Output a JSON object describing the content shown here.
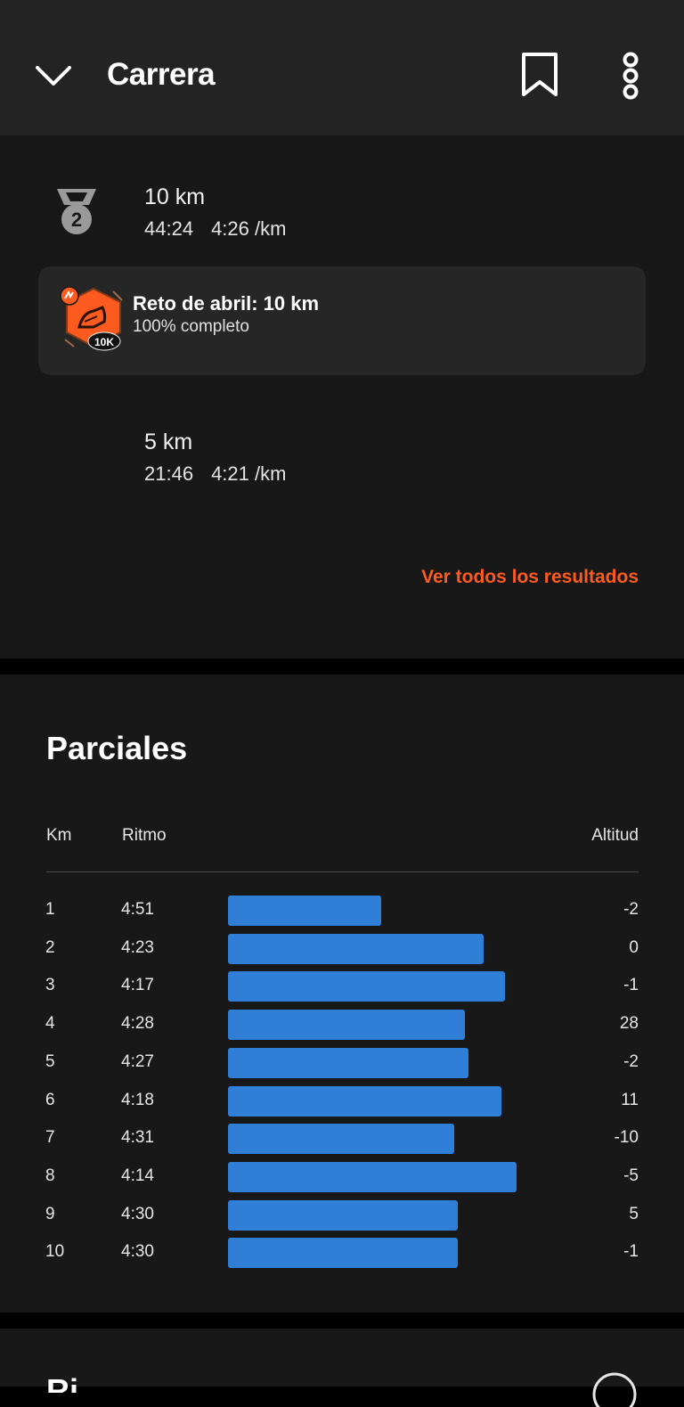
{
  "header": {
    "title": "Carrera"
  },
  "best_efforts": [
    {
      "distance": "10 km",
      "time": "44:24",
      "pace": "4:26 /km",
      "medal": "2"
    },
    {
      "distance": "5 km",
      "time": "21:46",
      "pace": "4:21 /km"
    }
  ],
  "challenge": {
    "title": "Reto de abril: 10 km",
    "status": "100% completo",
    "badge_label": "10K"
  },
  "see_all_label": "Ver todos los resultados",
  "splits": {
    "title": "Parciales",
    "col_km": "Km",
    "col_pace": "Ritmo",
    "col_alt": "Altitud",
    "rows": [
      {
        "km": "1",
        "pace": "4:51",
        "pace_sec": 291,
        "alt": "-2"
      },
      {
        "km": "2",
        "pace": "4:23",
        "pace_sec": 263,
        "alt": "0"
      },
      {
        "km": "3",
        "pace": "4:17",
        "pace_sec": 257,
        "alt": "-1"
      },
      {
        "km": "4",
        "pace": "4:28",
        "pace_sec": 268,
        "alt": "28"
      },
      {
        "km": "5",
        "pace": "4:27",
        "pace_sec": 267,
        "alt": "-2"
      },
      {
        "km": "6",
        "pace": "4:18",
        "pace_sec": 258,
        "alt": "11"
      },
      {
        "km": "7",
        "pace": "4:31",
        "pace_sec": 271,
        "alt": "-10"
      },
      {
        "km": "8",
        "pace": "4:14",
        "pace_sec": 254,
        "alt": "-5"
      },
      {
        "km": "9",
        "pace": "4:30",
        "pace_sec": 270,
        "alt": "5"
      },
      {
        "km": "10",
        "pace": "4:30",
        "pace_sec": 270,
        "alt": "-1"
      }
    ]
  },
  "next_section_title": "Ri",
  "colors": {
    "accent": "#fc5a1e",
    "bar": "#2f7fd9"
  }
}
